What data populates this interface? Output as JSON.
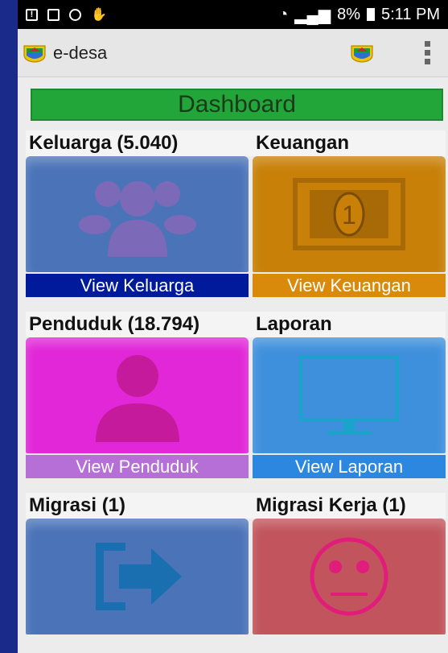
{
  "statusbar": {
    "signal": "8%",
    "time": "5:11 PM"
  },
  "app": {
    "title": "e-desa"
  },
  "dashboard": {
    "label": "Dashboard"
  },
  "tiles": [
    {
      "title": "Keluarga (5.040)",
      "view": "View Keluarga",
      "icon": "family-group-icon",
      "tile_color": "#4a73b8",
      "view_color": "#001a9c"
    },
    {
      "title": "Keuangan",
      "view": "View Keuangan",
      "icon": "banknote-icon",
      "tile_color": "#c88008",
      "view_color": "#d98a0b"
    },
    {
      "title": "Penduduk (18.794)",
      "view": "View Penduduk",
      "icon": "person-icon",
      "tile_color": "#e127d8",
      "view_color": "#b66fd6"
    },
    {
      "title": "Laporan",
      "view": "View Laporan",
      "icon": "monitor-icon",
      "tile_color": "#3f90dc",
      "view_color": "#2c87e0"
    },
    {
      "title": "Migrasi (1)",
      "view": "",
      "icon": "exit-arrow-icon",
      "tile_color": "#4a73b8",
      "view_color": "#4a73b8"
    },
    {
      "title": "Migrasi Kerja (1)",
      "view": "",
      "icon": "sad-face-icon",
      "tile_color": "#c1545c",
      "view_color": "#c1545c"
    }
  ]
}
